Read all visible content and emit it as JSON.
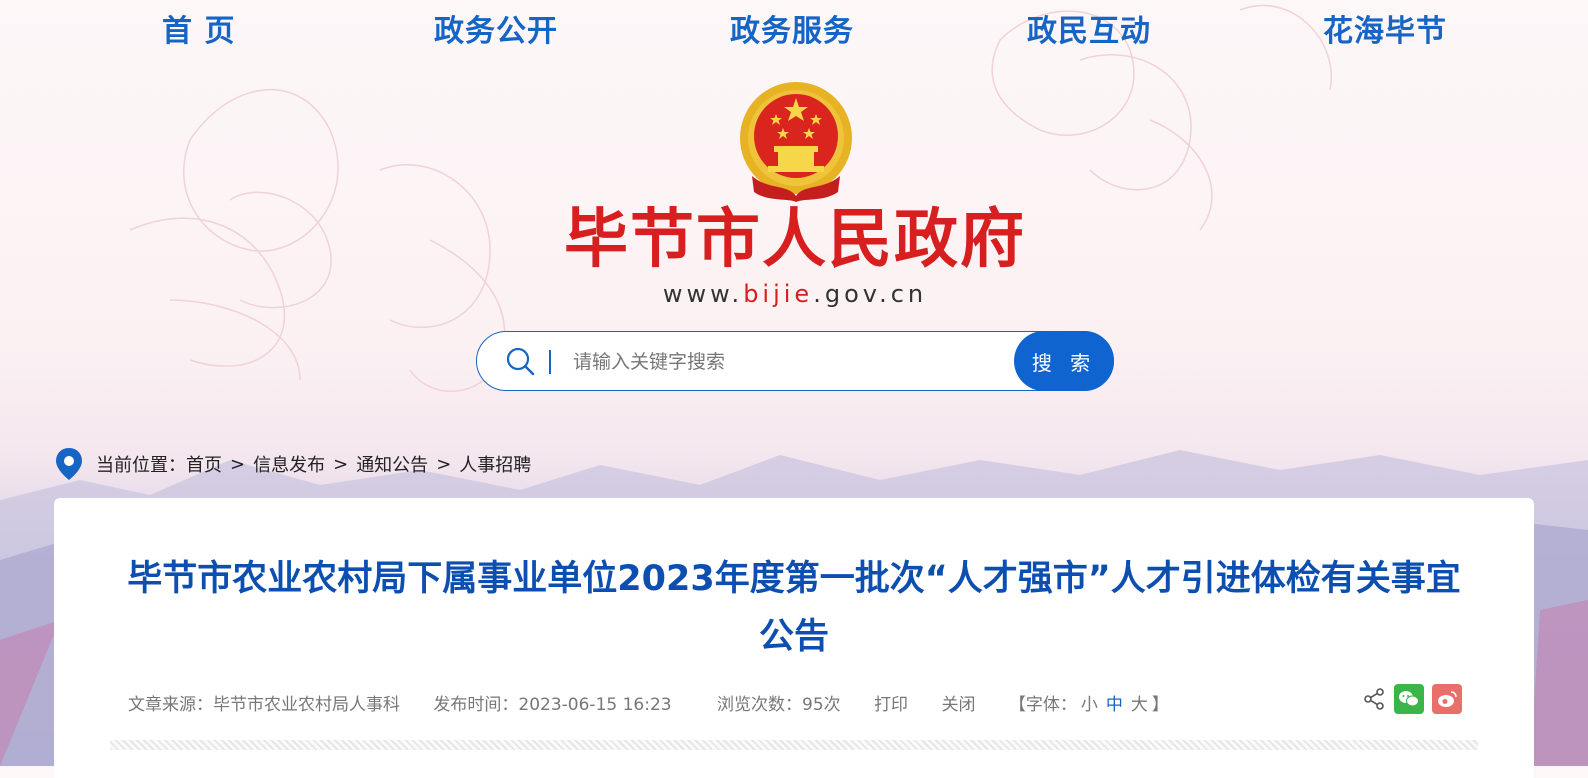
{
  "nav": {
    "items": [
      {
        "label": "首 页"
      },
      {
        "label": "政务公开"
      },
      {
        "label": "政务服务"
      },
      {
        "label": "政民互动"
      },
      {
        "label": "花海毕节"
      }
    ]
  },
  "header": {
    "site_title": "毕节市人民政府",
    "url_prefix": "www.",
    "url_highlight": "bijie",
    "url_suffix": ".gov.cn",
    "emblem_icon": "national-emblem-icon"
  },
  "search": {
    "placeholder": "请输入关键字搜索",
    "button_label": "搜 索"
  },
  "breadcrumb": {
    "prefix": "当前位置：",
    "items": [
      "首页",
      "信息发布",
      "通知公告",
      "人事招聘"
    ],
    "separator": ">"
  },
  "article": {
    "title": "毕节市农业农村局下属事业单位2023年度第一批次“人才强市”人才引进体检有关事宜公告",
    "source_label": "文章来源：",
    "source": "毕节市农业农村局人事科",
    "publish_label": "发布时间：",
    "publish_time": "2023-06-15 16:23",
    "views_label": "浏览次数：",
    "views": "95次",
    "print_label": "打印",
    "close_label": "关闭",
    "font_open": "【字体：",
    "font_small": "小",
    "font_medium": "中",
    "font_large": "大",
    "font_close": "】"
  },
  "colors": {
    "nav_blue": "#1664c4",
    "title_red": "#d71f1f",
    "article_title_blue": "#0d4fb0",
    "search_button": "#1064d0"
  }
}
